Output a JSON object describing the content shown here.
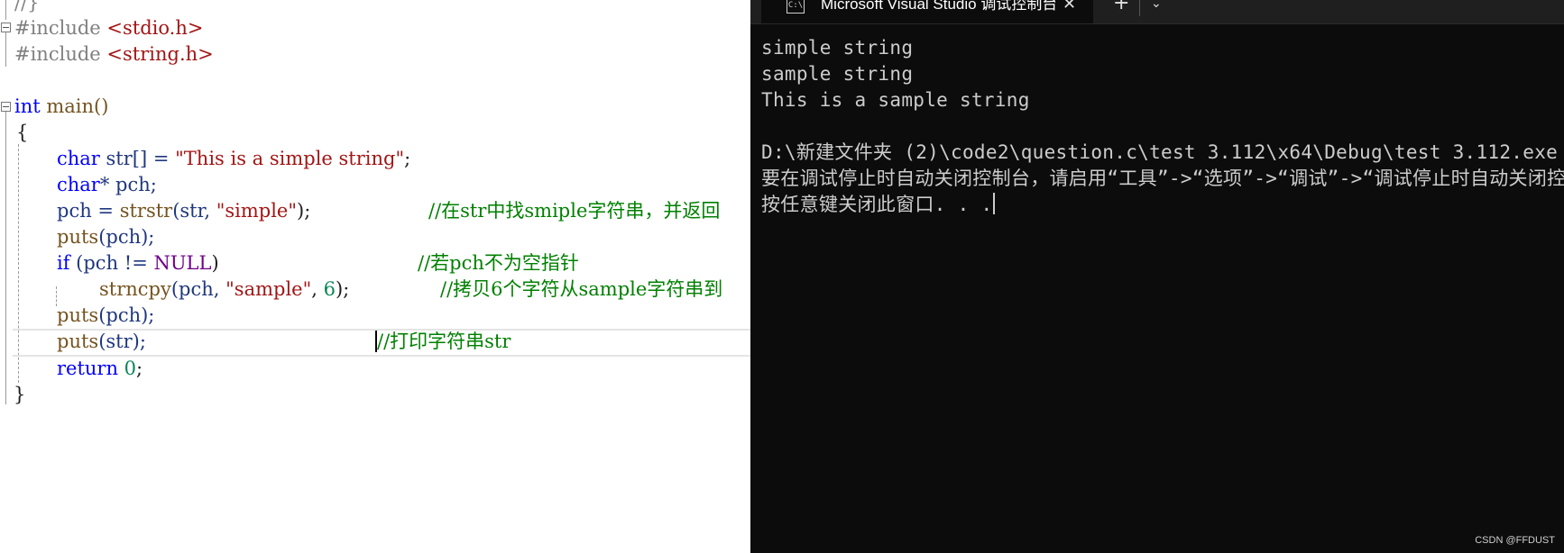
{
  "editor": {
    "top_fragment": "//}",
    "lines": {
      "inc1_kw": "#include",
      "inc1_hdr": "<stdio.h>",
      "inc2_kw": "#include",
      "inc2_hdr": "<string.h>",
      "main_kw": "int",
      "main_rest": " main()",
      "open_brace": "{",
      "l1_type": "char",
      "l1_var": " str[] = ",
      "l1_str": "\"This is a simple string\"",
      "l1_end": ";",
      "l2_type": "char",
      "l2_rest": "* pch;",
      "l3_var": "pch = ",
      "l3_fn": "strstr",
      "l3_args": "(str, ",
      "l3_str": "\"simple\"",
      "l3_end": ");",
      "l3_cmt": "//在str中找smiple字符串，并返回",
      "l4_fn": "puts",
      "l4_args": "(pch);",
      "l5_kw": "if",
      "l5_cond": " (pch != ",
      "l5_macro": "NULL",
      "l5_end": ")",
      "l5_cmt": "//若pch不为空指针",
      "l6_fn": "strncpy",
      "l6_args": "(pch, ",
      "l6_str": "\"sample\"",
      "l6_sep": ", ",
      "l6_num": "6",
      "l6_end": ");",
      "l6_cmt": "//拷贝6个字符从sample字符串到",
      "l7_fn": "puts",
      "l7_args": "(pch);",
      "l8_fn": "puts",
      "l8_args": "(str);",
      "l8_cmt": "//打印字符串str",
      "l9_kw": "return",
      "l9_num": " 0",
      "l9_end": ";",
      "close_brace": "}"
    }
  },
  "terminal": {
    "tab_title": "Microsoft Visual Studio 调试控制台",
    "tab_icon_text": "C:\\",
    "close_glyph": "✕",
    "new_tab_glyph": "+",
    "dropdown_glyph": "⌄",
    "output": [
      "simple string",
      "sample string",
      "This is a sample string",
      "",
      "D:\\新建文件夹 (2)\\code2\\question.c\\test 3.112\\x64\\Debug\\test 3.112.exe",
      "要在调试停止时自动关闭控制台，请启用“工具”->“选项”->“调试”->“调试停止时自动关闭控制台”。",
      "按任意键关闭此窗口. . ."
    ]
  },
  "watermark": "CSDN @FFDUST",
  "colors": {
    "keyword": "#0000ff",
    "string": "#a31515",
    "comment": "#008000",
    "macro": "#6f008a",
    "function": "#74531f",
    "terminal_bg": "#0c0c0c",
    "terminal_text": "#cccccc"
  }
}
